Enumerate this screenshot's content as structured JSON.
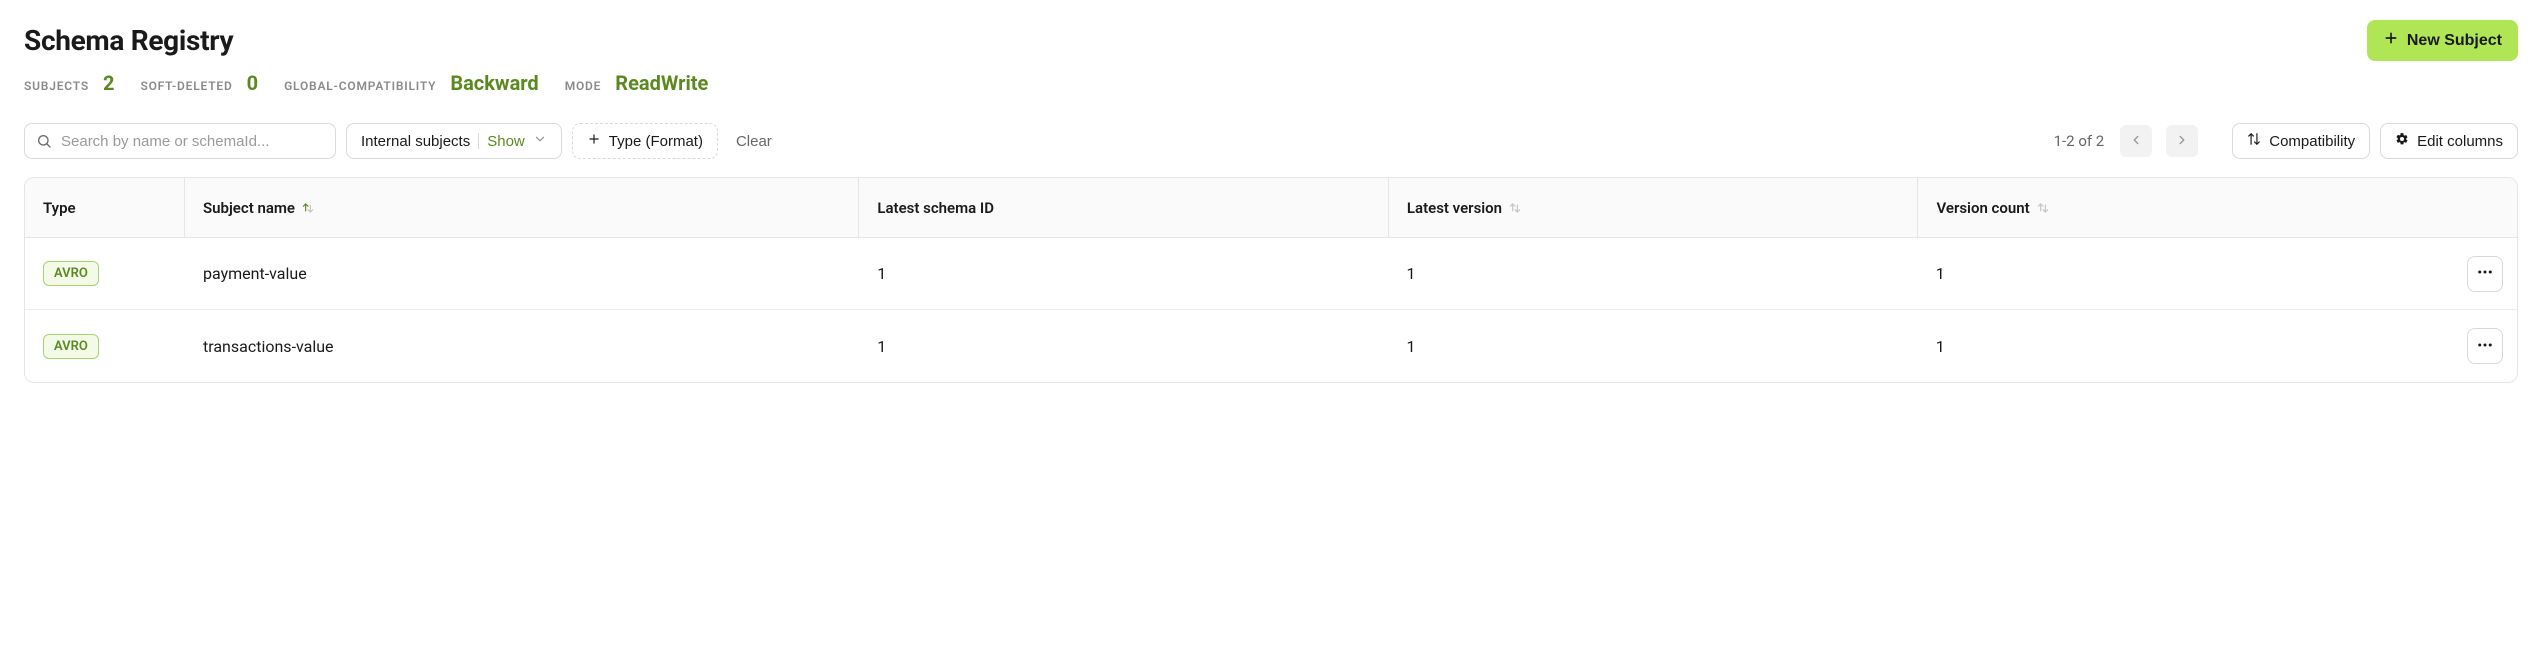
{
  "header": {
    "title": "Schema Registry",
    "new_subject_label": "New Subject"
  },
  "stats": {
    "subjects_label": "SUBJECTS",
    "subjects_value": "2",
    "softdeleted_label": "SOFT-DELETED",
    "softdeleted_value": "0",
    "global_compat_label": "GLOBAL-COMPATIBILITY",
    "global_compat_value": "Backward",
    "mode_label": "MODE",
    "mode_value": "ReadWrite"
  },
  "toolbar": {
    "search_placeholder": "Search by name or schemaId...",
    "internal_subjects_label": "Internal subjects",
    "internal_subjects_value": "Show",
    "type_filter_label": "Type (Format)",
    "clear_label": "Clear",
    "page_info": "1-2 of 2",
    "compatibility_label": "Compatibility",
    "edit_columns_label": "Edit columns"
  },
  "table": {
    "headers": {
      "type": "Type",
      "name": "Subject name",
      "latest_id": "Latest schema ID",
      "latest_version": "Latest version",
      "version_count": "Version count"
    },
    "rows": [
      {
        "type": "AVRO",
        "name": "payment-value",
        "latest_id": "1",
        "latest_version": "1",
        "version_count": "1"
      },
      {
        "type": "AVRO",
        "name": "transactions-value",
        "latest_id": "1",
        "latest_version": "1",
        "version_count": "1"
      }
    ]
  }
}
